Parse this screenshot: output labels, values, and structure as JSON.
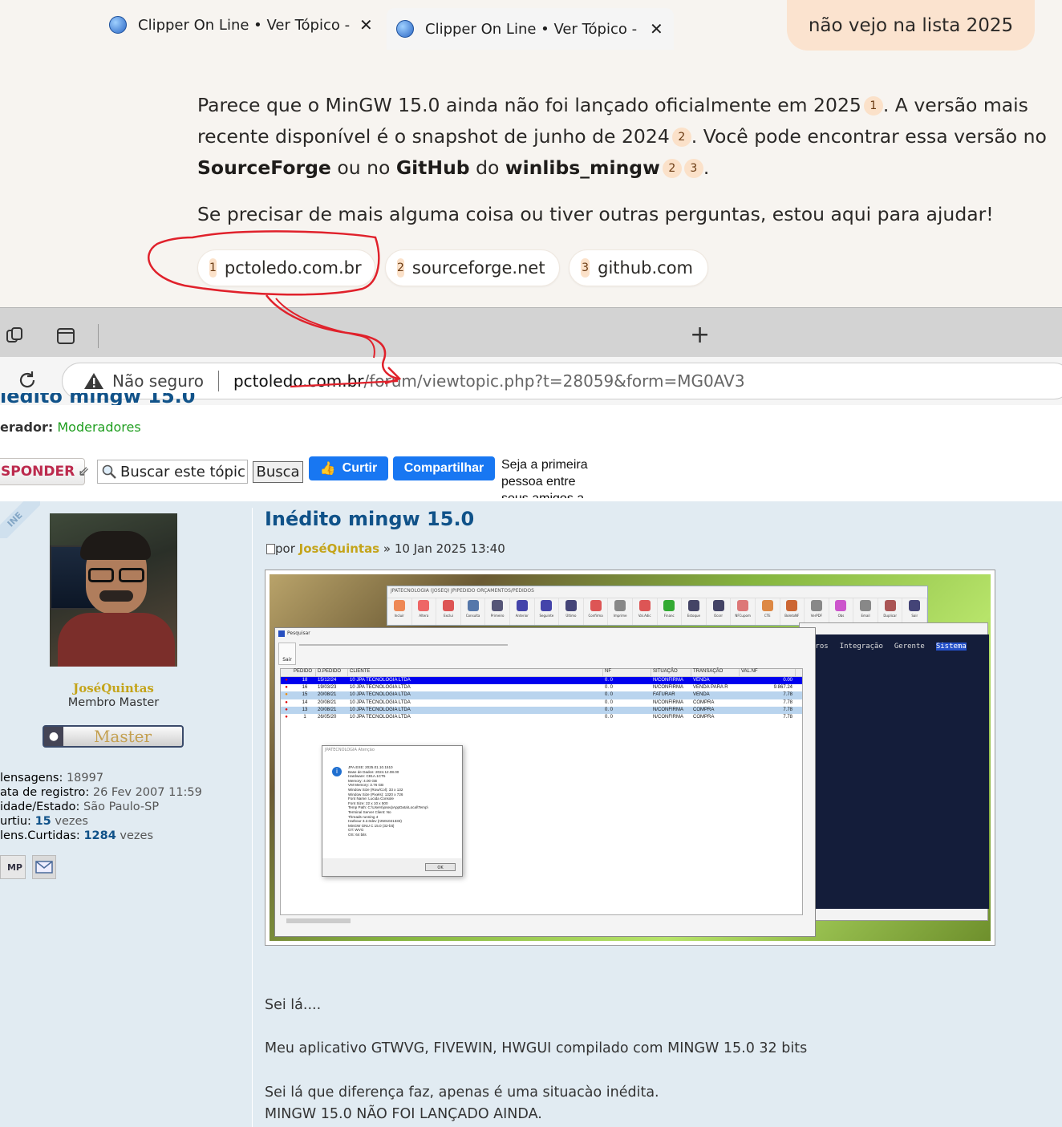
{
  "chat": {
    "user_message": "não vejo na lista 2025",
    "p1_a": "Parece que o MinGW 15.0 ainda não foi lançado oficialmente em 2025",
    "p1_b": ". A versão mais recente disponível é o snapshot de junho de 2024",
    "p1_c": ". Você pode encontrar essa versão no ",
    "p1_sourceforge": "SourceForge",
    "p1_d": " ou no ",
    "p1_github": "GitHub",
    "p1_e": " do ",
    "p1_winlibs": "winlibs_mingw",
    "p1_end": ".",
    "p2": "Se precisar de mais alguma coisa ou tiver outras perguntas, estou aqui para ajudar!",
    "citations": [
      "1",
      "2",
      "2",
      "3"
    ],
    "sources": [
      {
        "num": "1",
        "label": "pctoledo.com.br"
      },
      {
        "num": "2",
        "label": "sourceforge.net"
      },
      {
        "num": "3",
        "label": "github.com"
      }
    ]
  },
  "browser": {
    "tabs": [
      {
        "title": "Clipper On Line • Ver Tópico - Per"
      },
      {
        "title": "Clipper On Line • Ver Tópico - Iné"
      }
    ],
    "not_secure": "Não seguro",
    "url_host": "pctoledo.com.br",
    "url_path": "/forum/viewtopic.php?t=28059&form=MG0AV3"
  },
  "forum": {
    "title_partial": "ıédito mingw 15.0",
    "moderator_label": "erador:",
    "moderator_value": "Moderadores",
    "reply_button": "SPONDER",
    "search_placeholder": "Buscar este tópic",
    "search_button": "Busca",
    "fb_like": "Curtir",
    "fb_share": "Compartilhar",
    "fb_text": "Seja a primeira pessoa entre seus amigos a",
    "online_badge": "INE",
    "post_title": "Inédito mingw 15.0",
    "by_prefix": "por",
    "by_user": "JoséQuintas",
    "by_date": "» 10 Jan 2025 13:40",
    "profile": {
      "username": "JoséQuintas",
      "rank": "Membro Master",
      "rank_badge": "Master",
      "rows": [
        {
          "label": "lensagens:",
          "value": "18997"
        },
        {
          "label": "ata de registro:",
          "value": "26 Fev 2007 11:59"
        },
        {
          "label": "idade/Estado:",
          "value": "São Paulo-SP"
        }
      ],
      "curtiu_label": "urtiu:",
      "curtiu_value": "15",
      "curtiu_suffix": "vezes",
      "curtidas_label": "lens.Curtidas:",
      "curtidas_value": "1284",
      "curtidas_suffix": "vezes",
      "pm_label": "MP"
    },
    "body": [
      "Sei lá....",
      "Meu aplicativo GTWVG, FIVEWIN, HWGUI compilado com MINGW 15.0 32 bits",
      "Sei lá que diferença faz, apenas é uma situacào inédita.",
      "MINGW 15.0 NÃO FOI LANÇADO AINDA."
    ]
  },
  "screenshot": {
    "main_title": "JPATECNOLOGIA (JOSEQ) JPIPEDIDO ORÇAMENTOS/PEDIDOS",
    "toolbar": [
      "Incluir",
      "Altera",
      "Exclui",
      "Consulta",
      "Primeiro",
      "Anterior",
      "Seguinte",
      "Último",
      "Confirma",
      "Imprime",
      "Val.Adic",
      "Financ",
      "Estoque",
      "Ocorr",
      "NFCupom",
      "CTE",
      "BoletoNF",
      "VerPDF",
      "Obs",
      "Email",
      "Duplicar",
      "Sair"
    ],
    "menu": [
      "tros",
      "Integração",
      "Gerente",
      "Sistema"
    ],
    "search_title": "Pesquisar",
    "sair": "Sair",
    "columns": [
      "PEDIDO",
      "D.PEDIDO",
      "CLIENTE",
      "NF",
      "SITUAÇÃO",
      "TRANSAÇÃO",
      "VAL.NF"
    ],
    "rows": [
      [
        "18",
        "15/12/24",
        "10 JPA TECNOLOGIA LTDA",
        "0.",
        "0",
        "N/CONFIRMA",
        "VENDA",
        "0.00"
      ],
      [
        "16",
        "19/03/23",
        "10 JPA TECNOLOGIA LTDA",
        "0.",
        "0",
        "N/CONFIRMA",
        "VENDA PARA R",
        "9.867.24"
      ],
      [
        "15",
        "20/08/21",
        "10 JPA TECNOLOGIA LTDA",
        "0.",
        "0",
        "FATURAR",
        "VENDA",
        "7.78"
      ],
      [
        "14",
        "20/08/21",
        "10 JPA TECNOLOGIA LTDA",
        "0.",
        "0",
        "N/CONFIRMA",
        "COMPRA",
        "7.78"
      ],
      [
        "13",
        "20/08/21",
        "10 JPA TECNOLOGIA LTDA",
        "0.",
        "0",
        "N/CONFIRMA",
        "COMPRA",
        "7.78"
      ],
      [
        "1",
        "26/05/20",
        "10 JPA TECNOLOGIA LTDA",
        "0.",
        "0",
        "N/CONFIRMA",
        "COMPRA",
        "7.78"
      ]
    ],
    "about_title": "JPATECNOLOGIA Atenção",
    "about_lines": [
      "JPA.EXE: 2025.01.10.1510",
      "Base de Dados: 2024.12.08.00",
      "Hardware: C81A.1CT5",
      "Memory: 4.00 GB",
      "VM Memory: 3.76 GB",
      "Window Size (Row/Col): 33 x 132",
      "Window Size (Pixels): 1320 x 726",
      "Font Name: Lucida Console",
      "Font Size: 22 x 10 x 500",
      "Temp Path: C:\\Users\\joseq\\AppData\\Local\\Temp\\",
      "Terminal Server Client: No",
      "Threads running 4",
      "Harbour 3.2.0dev (r2501021333)",
      "MinGW GNU C 15.0 (32-bit)",
      "GT: WVG",
      "OS: 64 bits"
    ],
    "ok": "OK"
  },
  "colors": {
    "accent_peach": "#fbe1c9",
    "annotation_red": "#e0212b",
    "forum_blue": "#105289",
    "user_gold": "#c4a41a"
  }
}
